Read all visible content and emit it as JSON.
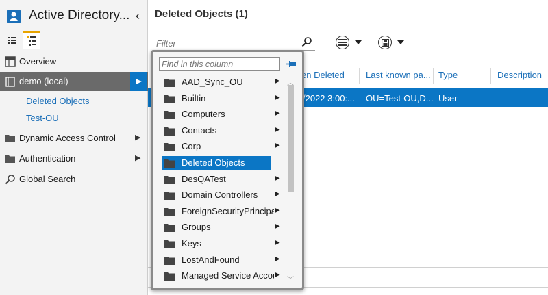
{
  "app": {
    "title": "Active Directory...",
    "collapse_icon": "chevron-left-icon"
  },
  "view_tabs": [
    {
      "name": "list-view",
      "icon": "list-icon"
    },
    {
      "name": "tree-view",
      "icon": "tree-icon"
    }
  ],
  "sidebar": {
    "items": [
      {
        "label": "Overview",
        "icon": "overview-icon"
      },
      {
        "label": "demo (local)",
        "icon": "domain-icon",
        "selected": true
      },
      {
        "label": "Deleted Objects",
        "sub": true
      },
      {
        "label": "Test-OU",
        "sub": true
      },
      {
        "label": "Dynamic Access Control",
        "icon": "folder-icon",
        "has_children": true
      },
      {
        "label": "Authentication",
        "icon": "folder-icon",
        "has_children": true
      },
      {
        "label": "Global Search",
        "icon": "search-icon"
      }
    ]
  },
  "main": {
    "title": "Deleted Objects  (1)",
    "filter_placeholder": "Filter",
    "columns": [
      "en Deleted",
      "Last known pa...",
      "Type",
      "Description"
    ],
    "rows": [
      {
        "when_deleted": "/2022 3:00:...",
        "last_known_parent": "OU=Test-OU,D...",
        "type": "User",
        "description": ""
      }
    ]
  },
  "popup": {
    "search_placeholder": "Find in this column",
    "items": [
      {
        "label": "AAD_Sync_OU",
        "has_children": true
      },
      {
        "label": "Builtin",
        "has_children": true
      },
      {
        "label": "Computers",
        "has_children": true
      },
      {
        "label": "Contacts",
        "has_children": true
      },
      {
        "label": "Corp",
        "has_children": true
      },
      {
        "label": "Deleted Objects",
        "has_children": false,
        "selected": true
      },
      {
        "label": "DesQATest",
        "has_children": true
      },
      {
        "label": "Domain Controllers",
        "has_children": true
      },
      {
        "label": "ForeignSecurityPrincipa",
        "has_children": true
      },
      {
        "label": "Groups",
        "has_children": true
      },
      {
        "label": "Keys",
        "has_children": true
      },
      {
        "label": "LostAndFound",
        "has_children": true
      },
      {
        "label": "Managed Service Accou",
        "has_children": true
      }
    ]
  },
  "colors": {
    "accent": "#0b76c5",
    "sidebar_selected": "#6a6a6a",
    "link": "#1b6fb8"
  }
}
